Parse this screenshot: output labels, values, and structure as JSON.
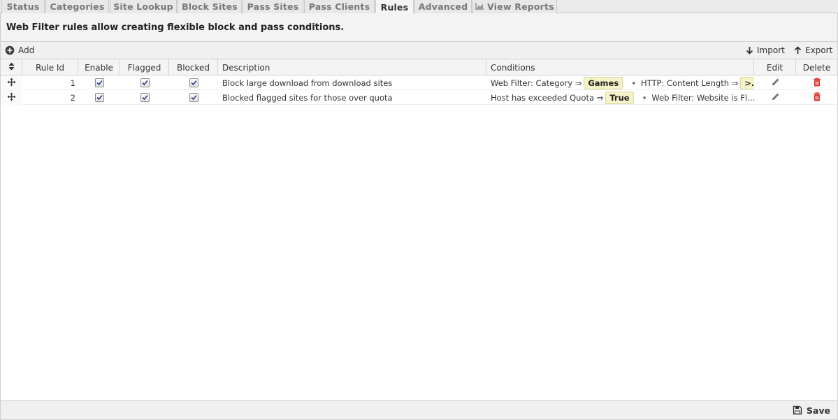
{
  "tabs": [
    {
      "label": "Status"
    },
    {
      "label": "Categories"
    },
    {
      "label": "Site Lookup"
    },
    {
      "label": "Block Sites"
    },
    {
      "label": "Pass Sites"
    },
    {
      "label": "Pass Clients"
    },
    {
      "label": "Rules",
      "active": true
    },
    {
      "label": "Advanced"
    },
    {
      "label": "View Reports",
      "icon": "chart-icon"
    }
  ],
  "description": "Web Filter rules allow creating flexible block and pass conditions.",
  "toolbar": {
    "add_label": "Add",
    "import_label": "Import",
    "export_label": "Export"
  },
  "columns": {
    "rule_id": "Rule Id",
    "enable": "Enable",
    "flagged": "Flagged",
    "blocked": "Blocked",
    "description": "Description",
    "conditions": "Conditions",
    "edit": "Edit",
    "delete": "Delete"
  },
  "rows": [
    {
      "rule_id": "1",
      "enable": true,
      "flagged": true,
      "blocked": true,
      "description": "Block large download from download sites",
      "cond1_label": "Web Filter: Category ⇒",
      "cond1_value": "Games",
      "cond2_label": "HTTP: Content Length ⇒",
      "cond2_value": ">..."
    },
    {
      "rule_id": "2",
      "enable": true,
      "flagged": true,
      "blocked": true,
      "description": "Blocked flagged sites for those over quota",
      "cond1_label": "Host has exceeded Quota ⇒",
      "cond1_value": "True",
      "cond2_label": "Web Filter: Website is Fl...",
      "cond2_value": ""
    }
  ],
  "footer": {
    "save_label": "Save"
  },
  "colors": {
    "delete_icon": "#d9302c",
    "condition_highlight": "#f5f3c8"
  }
}
